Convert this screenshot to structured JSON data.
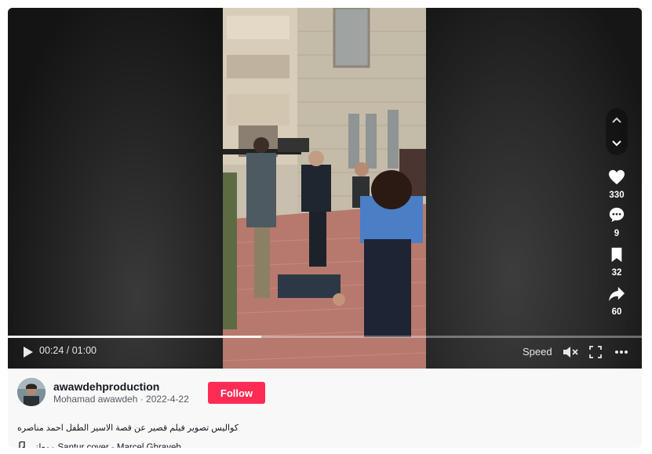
{
  "video": {
    "time_display": "00:24 / 01:00",
    "progress": 0.4,
    "speed_label": "Speed"
  },
  "actions": {
    "likes": "330",
    "comments": "9",
    "saves": "32",
    "shares": "60"
  },
  "author": {
    "username": "awawdehproduction",
    "nickname_date": "Mohamad awawdeh · 2022-4-22",
    "follow_label": "Follow"
  },
  "description": "كواليس تصوير فيلم قصير عن قصة الاسير الطفل احمد مناصره",
  "music": "موطني Santur cover - Marcel Ghrayeb",
  "colors": {
    "accent": "#fe2c55",
    "text": "#161823",
    "muted": "#555a63"
  },
  "icons": [
    "play-icon",
    "mute-icon",
    "fullscreen-icon",
    "more-icon",
    "heart-icon",
    "comment-icon",
    "bookmark-icon",
    "share-icon",
    "chevron-up-icon",
    "chevron-down-icon",
    "music-note-icon"
  ]
}
